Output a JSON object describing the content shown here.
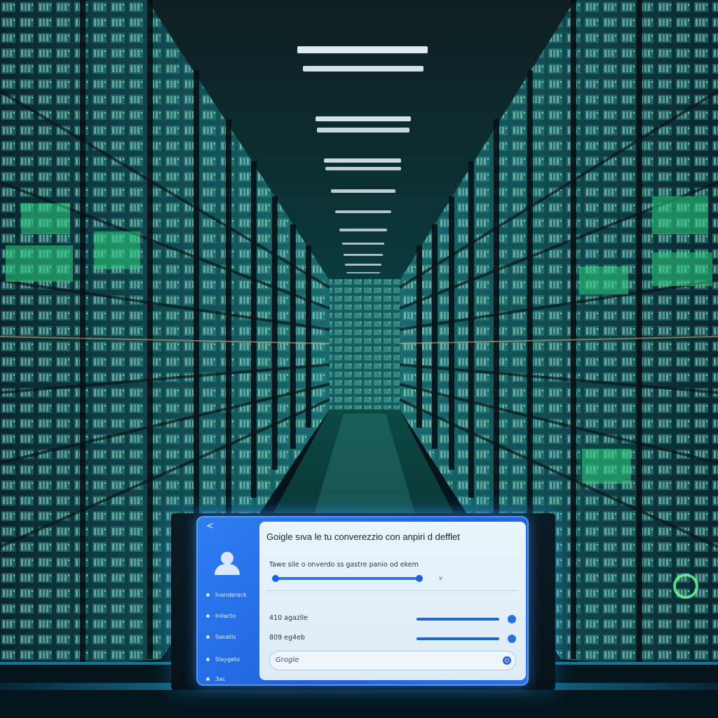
{
  "colors": {
    "accent": "#2a6fe8",
    "glow": "#39d0ff",
    "servers": "#1ea37a"
  },
  "icons": {
    "back": "back-arrow-icon",
    "profile": "user-icon",
    "search": "search-icon"
  },
  "panel": {
    "back_label": "<",
    "title": "Goigle sıva le tu converezzio con anpiri d defflet",
    "subtitle": "Tawe sile o onverdo ss gastre panio od ekem",
    "slider_end_label": "v",
    "slider_value": 0.93,
    "sidebar": {
      "items": [
        {
          "label": "Inanderack"
        },
        {
          "label": "Inilacto"
        },
        {
          "label": "Sanatis"
        },
        {
          "label": "Slaygeto"
        },
        {
          "label": "3ac"
        }
      ]
    },
    "stats": [
      {
        "label": "410 agazlle",
        "value": 1.0
      },
      {
        "label": "809 eg4eb",
        "value": 1.0
      }
    ],
    "search": {
      "value": "Grogle"
    }
  }
}
